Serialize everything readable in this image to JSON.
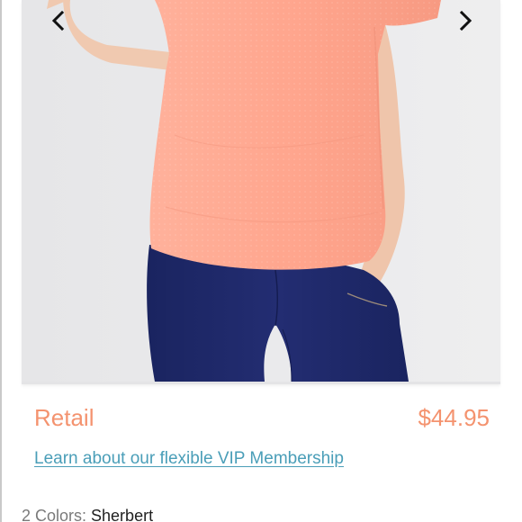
{
  "product": {
    "image": {
      "description_icon": "product-photo",
      "prev_icon": "chevron-left-icon",
      "next_icon": "chevron-right-icon"
    },
    "price": {
      "label": "Retail",
      "value": "$44.95",
      "color": "#f4936f"
    },
    "vip_link": {
      "text": "Learn about our flexible VIP Membership",
      "color": "#4a9eb8"
    },
    "colors": {
      "prefix": "2 Colors: ",
      "selected": "Sherbert"
    }
  },
  "palette": {
    "shirt": "#ffa089",
    "leggings": "#1d2766",
    "skin": "#f0c8ae",
    "background": "#e9e9eb"
  }
}
